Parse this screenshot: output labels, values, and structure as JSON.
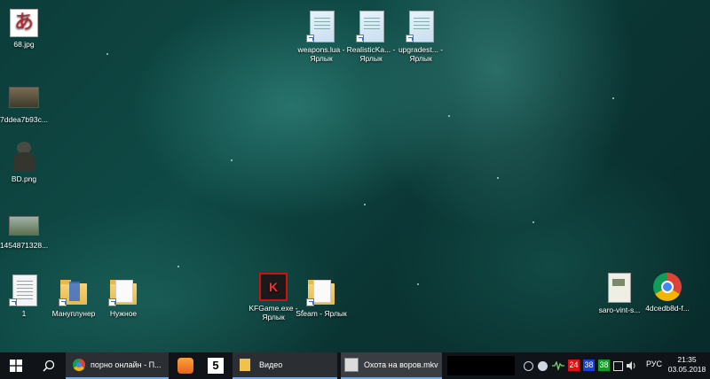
{
  "desktop": {
    "icons": [
      {
        "label": "68.jpg"
      },
      {
        "label": "7ddea7b93c..."
      },
      {
        "label": "BD.png"
      },
      {
        "label": "1454871328..."
      },
      {
        "label": "1"
      },
      {
        "label": "Мануплунер"
      },
      {
        "label": "Нужное"
      },
      {
        "label": "KFGame.exe - Ярлык"
      },
      {
        "label": "Steam - Ярлык"
      },
      {
        "label": "weapons.lua - Ярлык"
      },
      {
        "label": "RealisticKa... - Ярлык"
      },
      {
        "label": "upgradest... - Ярлык"
      },
      {
        "label": "saro-vint-s..."
      },
      {
        "label": "4dcedb8d-f..."
      }
    ],
    "icon_glyph_68": "あ"
  },
  "taskbar": {
    "tasks": [
      {
        "label": "порно онлайн - П..."
      },
      {
        "label": "Видео"
      },
      {
        "label": "Охота на воров.mkv"
      }
    ],
    "tray": {
      "badge1": "24",
      "badge2": "38",
      "badge3": "38",
      "lang": "РУС",
      "time": "21:35",
      "date": "03.05.2018"
    }
  },
  "colors": {
    "badge1": "#d11",
    "badge2": "#1a3fd6",
    "badge3": "#149c2a"
  }
}
